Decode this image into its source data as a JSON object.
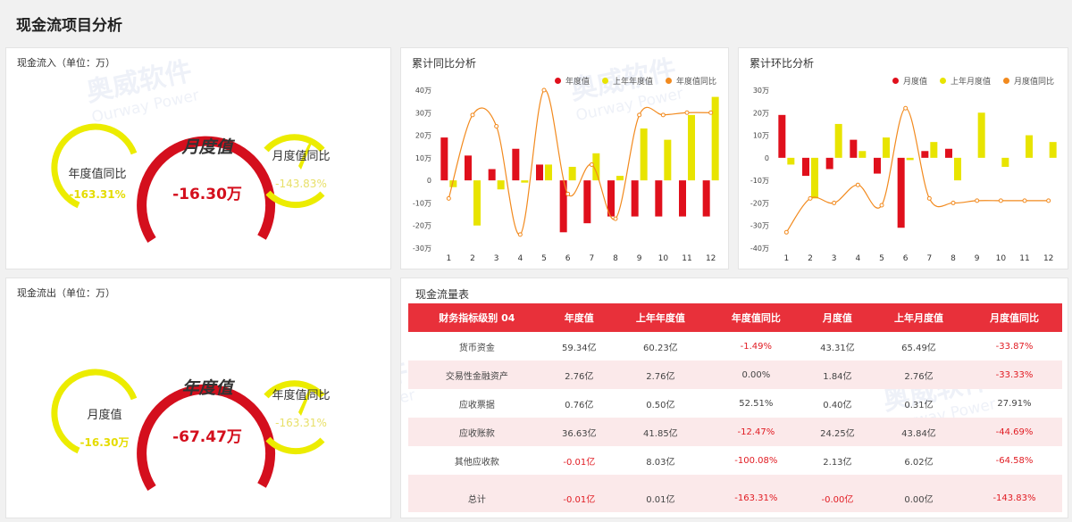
{
  "page": {
    "title": "现金流项目分析"
  },
  "inflow": {
    "title": "现金流入（单位：万）",
    "left": {
      "label": "年度值同比",
      "value": "-163.31%"
    },
    "center": {
      "label": "月度值",
      "value": "-16.30万"
    },
    "right": {
      "label": "月度值同比",
      "value": "-143.83%"
    }
  },
  "outflow": {
    "title": "现金流出（单位：万）",
    "left": {
      "label": "月度值",
      "value": "-16.30万"
    },
    "center": {
      "label": "年度值",
      "value": "-67.47万"
    },
    "right": {
      "label": "年度值同比",
      "value": "-163.31%"
    }
  },
  "watermark": {
    "brand": "奥威软件",
    "sub": "Ourway Power"
  },
  "colors": {
    "red": "#e0101c",
    "yellow": "#e8e400",
    "orange": "#f28a1e",
    "header": "#e8303a"
  },
  "chart_data": [
    {
      "type": "bar",
      "title": "累计同比分析",
      "categories": [
        "1",
        "2",
        "3",
        "4",
        "5",
        "6",
        "7",
        "8",
        "9",
        "10",
        "11",
        "12"
      ],
      "y_ticks": [
        "40万",
        "30万",
        "20万",
        "10万",
        "0",
        "-10万",
        "-20万",
        "-30万"
      ],
      "ylim": [
        -30,
        40
      ],
      "legend": [
        "年度值",
        "上年年度值",
        "年度值同比"
      ],
      "series": [
        {
          "name": "年度值",
          "kind": "bar",
          "values": [
            19,
            11,
            5,
            14,
            7,
            -23,
            -19,
            -16,
            -16,
            -16,
            -16,
            -16
          ]
        },
        {
          "name": "上年年度值",
          "kind": "bar",
          "values": [
            -3,
            -20,
            -4,
            -1,
            7,
            6,
            12,
            2,
            23,
            18,
            29,
            37
          ]
        },
        {
          "name": "年度值同比",
          "kind": "line",
          "values": [
            -8,
            29,
            24,
            -24,
            40,
            -6,
            7,
            -17,
            29,
            29,
            30,
            30
          ]
        }
      ]
    },
    {
      "type": "bar",
      "title": "累计环比分析",
      "categories": [
        "1",
        "2",
        "3",
        "4",
        "5",
        "6",
        "7",
        "8",
        "9",
        "10",
        "11",
        "12"
      ],
      "y_ticks": [
        "30万",
        "20万",
        "10万",
        "0",
        "-10万",
        "-20万",
        "-30万",
        "-40万"
      ],
      "ylim": [
        -40,
        30
      ],
      "legend": [
        "月度值",
        "上年月度值",
        "月度值同比"
      ],
      "series": [
        {
          "name": "月度值",
          "kind": "bar",
          "values": [
            19,
            -8,
            -5,
            8,
            -7,
            -31,
            3,
            4,
            0,
            0,
            0,
            0
          ]
        },
        {
          "name": "上年月度值",
          "kind": "bar",
          "values": [
            -3,
            -18,
            15,
            3,
            9,
            -1,
            7,
            -10,
            20,
            -4,
            10,
            7
          ]
        },
        {
          "name": "月度值同比",
          "kind": "line",
          "values": [
            -33,
            -18,
            -20,
            -12,
            -21,
            22,
            -18,
            -20,
            -19,
            -19,
            -19,
            -19
          ]
        }
      ]
    },
    {
      "type": "table",
      "title": "现金流量表",
      "columns": [
        "财务指标级别 04",
        "年度值",
        "上年年度值",
        "年度值同比",
        "月度值",
        "上年月度值",
        "月度值同比"
      ],
      "rows": [
        [
          "货币资金",
          "59.34亿",
          "60.23亿",
          "-1.49%",
          "43.31亿",
          "65.49亿",
          "-33.87%"
        ],
        [
          "交易性金融资产",
          "2.76亿",
          "2.76亿",
          "0.00%",
          "1.84亿",
          "2.76亿",
          "-33.33%"
        ],
        [
          "应收票据",
          "0.76亿",
          "0.50亿",
          "52.51%",
          "0.40亿",
          "0.31亿",
          "27.91%"
        ],
        [
          "应收账款",
          "36.63亿",
          "41.85亿",
          "-12.47%",
          "24.25亿",
          "43.84亿",
          "-44.69%"
        ],
        [
          "其他应收款",
          "-0.01亿",
          "8.03亿",
          "-100.08%",
          "2.13亿",
          "6.02亿",
          "-64.58%"
        ],
        [
          "总计",
          "-0.01亿",
          "0.01亿",
          "-163.31%",
          "-0.00亿",
          "0.00亿",
          "-143.83%"
        ]
      ]
    }
  ]
}
